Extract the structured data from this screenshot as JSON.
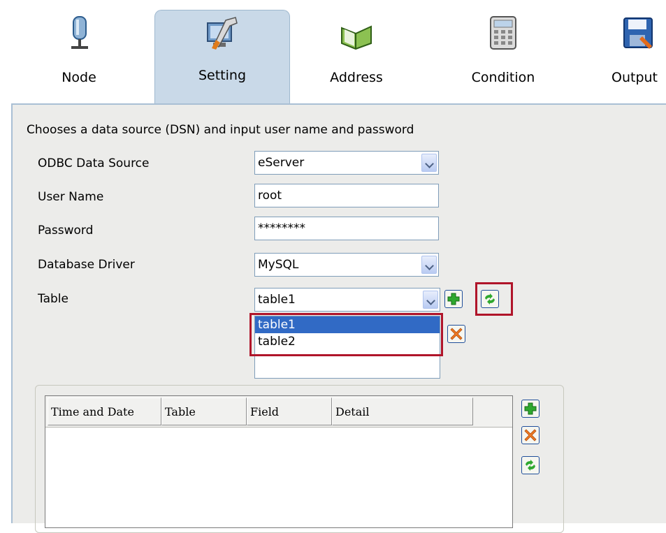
{
  "tabs": [
    {
      "label": "Node",
      "icon": "node-icon",
      "active": false
    },
    {
      "label": "Setting",
      "icon": "setting-icon",
      "active": true
    },
    {
      "label": "Address",
      "icon": "address-icon",
      "active": false
    },
    {
      "label": "Condition",
      "icon": "condition-icon",
      "active": false
    },
    {
      "label": "Output",
      "icon": "output-icon",
      "active": false
    }
  ],
  "panel": {
    "description": "Chooses a data source (DSN) and input user name and password",
    "odbc": {
      "label": "ODBC Data Source",
      "value": "eServer"
    },
    "user": {
      "label": "User Name",
      "value": "root"
    },
    "password": {
      "label": "Password",
      "value": "********"
    },
    "driver": {
      "label": "Database Driver",
      "value": "MySQL"
    },
    "table": {
      "label": "Table",
      "value": "table1",
      "options": [
        "table1",
        "table2"
      ]
    }
  },
  "log": {
    "columns": [
      "Time and Date",
      "Table",
      "Field",
      "Detail"
    ]
  },
  "colors": {
    "highlight": "#b0152a",
    "selection": "#316ac5",
    "accent_tab": "#c9d9e8"
  }
}
